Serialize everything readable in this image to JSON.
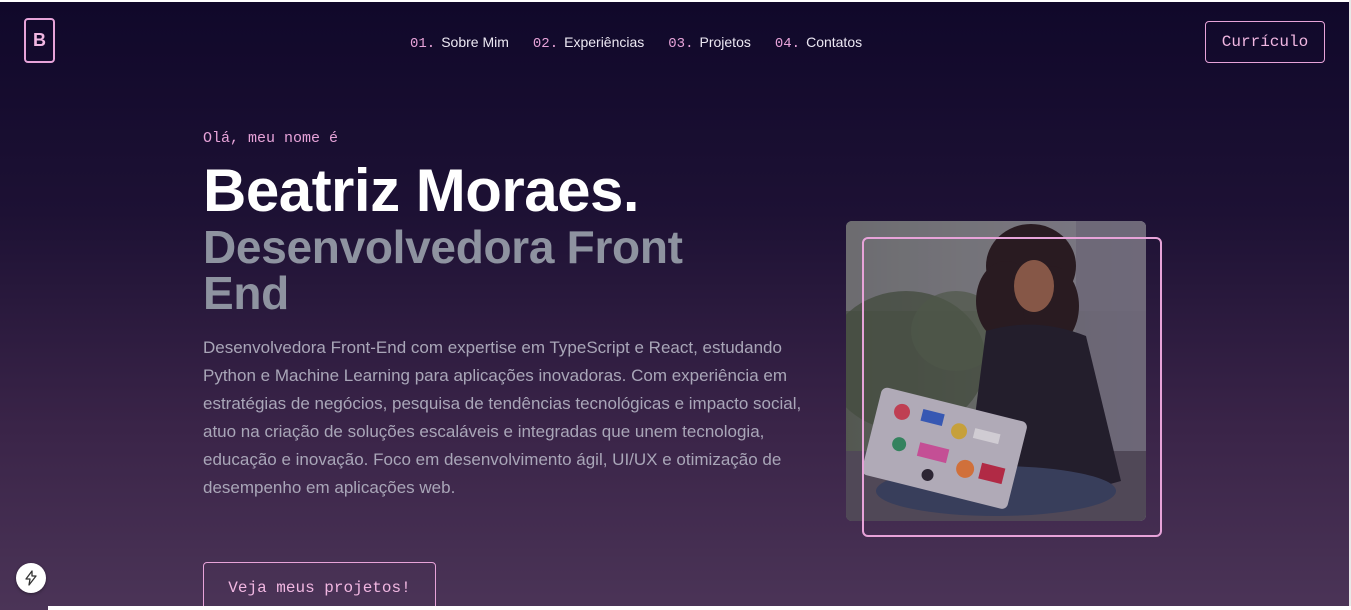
{
  "logo": {
    "letter": "B"
  },
  "nav": {
    "items": [
      {
        "number": "01.",
        "label": "Sobre Mim"
      },
      {
        "number": "02.",
        "label": "Experiências"
      },
      {
        "number": "03.",
        "label": "Projetos"
      },
      {
        "number": "04.",
        "label": "Contatos"
      }
    ]
  },
  "header": {
    "resume_label": "Currículo"
  },
  "hero": {
    "greeting": "Olá, meu nome é",
    "name": "Beatriz Moraes.",
    "role": "Desenvolvedora Front End",
    "bio": "Desenvolvedora Front-End com expertise em TypeScript e React, estudando Python e Machine Learning para aplicações inovadoras. Com experiência em estratégias de negócios, pesquisa de tendências tecnológicas e impacto social, atuo na criação de soluções escaláveis e integradas que unem tecnologia, educação e inovação. Foco em desenvolvimento ágil, UI/UX e otimização de desempenho em aplicações web.",
    "cta_label": "Veja meus projetos!"
  },
  "colors": {
    "accent": "#e7a3d9",
    "background_top": "#10082a",
    "background_bottom": "#4b3457",
    "heading": "#ffffff",
    "subheading": "#8e93a0",
    "body_text": "#a9a6b8"
  },
  "icons": {
    "dev_badge": "lightning-bolt-icon"
  }
}
